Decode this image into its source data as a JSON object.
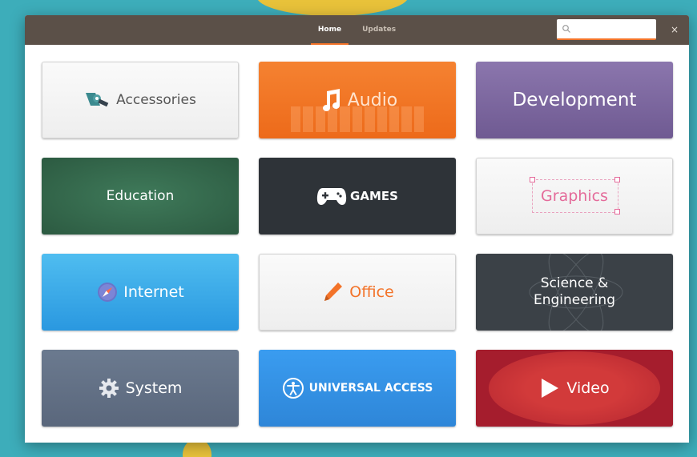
{
  "header": {
    "tabs": [
      {
        "label": "Home",
        "active": true
      },
      {
        "label": "Updates",
        "active": false
      }
    ],
    "search": {
      "value": "",
      "placeholder": ""
    },
    "close_symbol": "×"
  },
  "categories": [
    {
      "label": "Accessories",
      "icon": "accessories-icon"
    },
    {
      "label": "Audio",
      "icon": "music-note-icon"
    },
    {
      "label": "Development",
      "icon": ""
    },
    {
      "label": "Education",
      "icon": ""
    },
    {
      "label": "GAMES",
      "icon": "gamepad-icon"
    },
    {
      "label": "Graphics",
      "icon": "selection-frame-icon"
    },
    {
      "label": "Internet",
      "icon": "compass-icon"
    },
    {
      "label": "Office",
      "icon": "pencil-icon"
    },
    {
      "label": "Science &\nEngineering",
      "icon": "atom-icon"
    },
    {
      "label": "System",
      "icon": "gear-icon"
    },
    {
      "label": "UNIVERSAL ACCESS",
      "icon": "accessibility-icon"
    },
    {
      "label": "Video",
      "icon": "play-icon"
    }
  ],
  "colors": {
    "accent": "#f37329",
    "headerbar": "#5b5048",
    "desktop": "#3dadba"
  }
}
